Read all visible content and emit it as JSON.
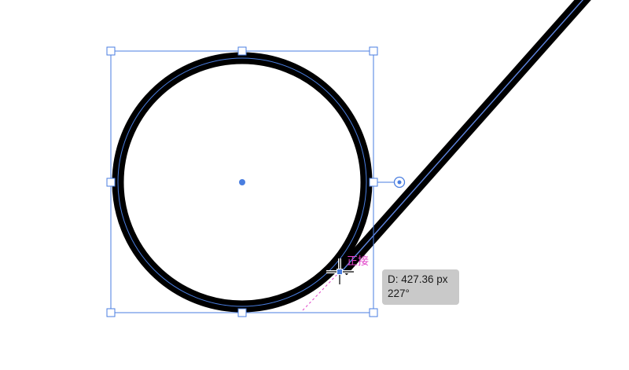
{
  "canvas": {
    "background": "#ffffff",
    "selection_color": "#4a7ee0",
    "smart_guide_color": "#e040c8",
    "stroke_color": "#000000"
  },
  "smart_guide": {
    "snap_label": "正接"
  },
  "tooltip": {
    "distance": "D: 427.36 px",
    "angle": "227°"
  },
  "icons": {
    "center_point": "center-point-icon",
    "rotate_handle": "rotate-handle-icon",
    "cursor": "crosshair-cursor-icon"
  }
}
